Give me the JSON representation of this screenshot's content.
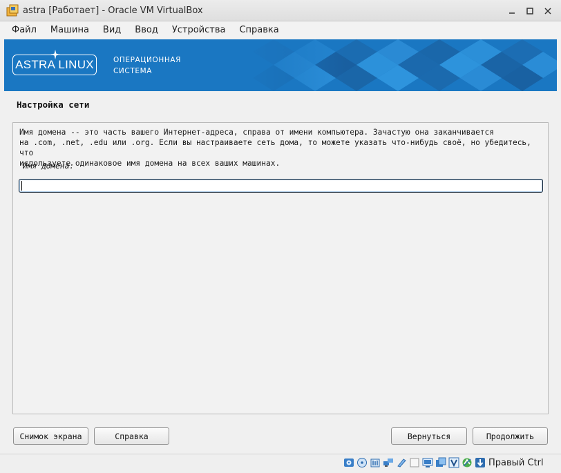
{
  "window": {
    "title": "astra [Работает] - Oracle VM VirtualBox"
  },
  "menu": {
    "items": [
      {
        "label": "Файл"
      },
      {
        "label": "Машина"
      },
      {
        "label": "Вид"
      },
      {
        "label": "Ввод"
      },
      {
        "label": "Устройства"
      },
      {
        "label": "Справка"
      }
    ]
  },
  "banner": {
    "logo_text": "ASTRA LINUX",
    "tagline_line1": "ОПЕРАЦИОННАЯ",
    "tagline_line2": "СИСТЕМА",
    "background_color": "#1a77c2"
  },
  "installer": {
    "page_title": "Настройка сети",
    "description_lines": [
      "Имя домена -- это часть вашего Интернет-адреса, справа от имени компьютера. Зачастую она заканчивается",
      "на .com, .net, .edu или .org. Если вы настраиваете сеть дома, то можете указать что-нибудь своё, но убедитесь, что",
      "используете одинаковое имя домена на всех ваших машинах."
    ],
    "field_label": "Имя домена:",
    "field_value": ""
  },
  "buttons": {
    "screenshot": "Снимок экрана",
    "help": "Справка",
    "back": "Вернуться",
    "continue": "Продолжить"
  },
  "statusbar": {
    "icons": [
      "hard-disk-icon",
      "optical-drive-icon",
      "audio-icon",
      "network-icon",
      "usb-icon",
      "shared-folders-icon",
      "display-icon",
      "video-capture-icon",
      "virtualization-icon",
      "mouse-integration-icon",
      "keyboard-capture-icon"
    ],
    "host_key": "Правый Ctrl"
  }
}
